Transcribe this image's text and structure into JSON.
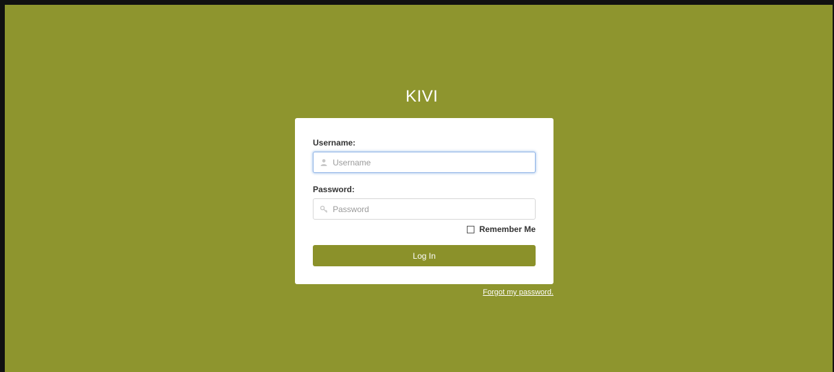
{
  "page": {
    "brand": "KIVI",
    "background_color": "#8e952e",
    "accent_color": "#8b912a"
  },
  "login_form": {
    "username_label": "Username:",
    "username_placeholder": "Username",
    "username_value": "",
    "username_icon": "user-icon",
    "password_label": "Password:",
    "password_placeholder": "Password",
    "password_value": "",
    "password_icon": "key-icon",
    "remember_label": "Remember Me",
    "remember_checked": false,
    "submit_label": "Log In"
  },
  "links": {
    "forgot_password": "Forgot my password."
  }
}
